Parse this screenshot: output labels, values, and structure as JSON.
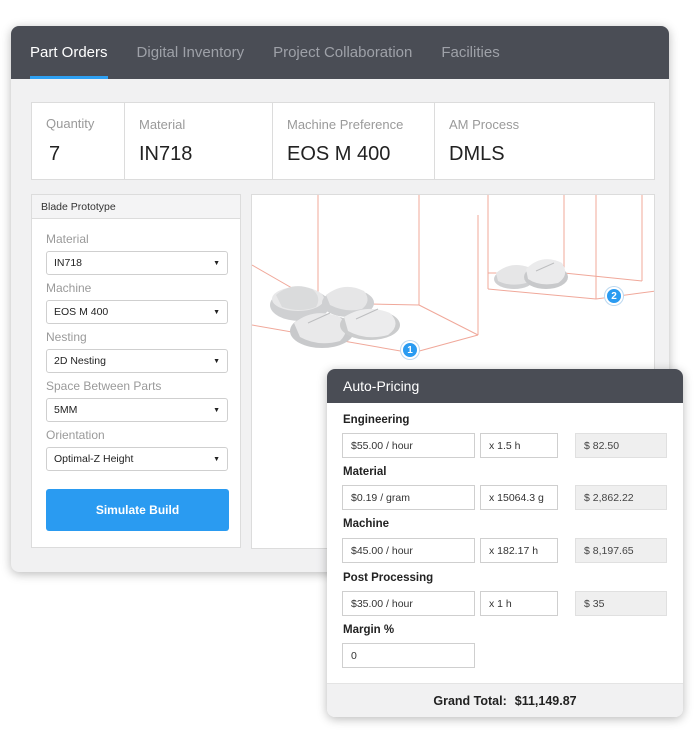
{
  "tabs": [
    {
      "label": "Part Orders",
      "active": true
    },
    {
      "label": "Digital Inventory",
      "active": false
    },
    {
      "label": "Project Collaboration",
      "active": false
    },
    {
      "label": "Facilities",
      "active": false
    }
  ],
  "summary": {
    "quantity": {
      "label": "Quantity",
      "value": "7"
    },
    "material": {
      "label": "Material",
      "value": "IN718"
    },
    "machine": {
      "label": "Machine Preference",
      "value": "EOS M 400"
    },
    "process": {
      "label": "AM  Process",
      "value": "DMLS"
    }
  },
  "panel": {
    "title": "Blade Prototype",
    "fields": {
      "material": {
        "label": "Material",
        "value": "IN718"
      },
      "machine": {
        "label": "Machine",
        "value": "EOS M 400"
      },
      "nesting": {
        "label": "Nesting",
        "value": "2D Nesting"
      },
      "spacing": {
        "label": "Space Between Parts",
        "value": "5MM"
      },
      "orientation": {
        "label": "Orientation",
        "value": "Optimal-Z Height"
      }
    },
    "simulate_label": "Simulate Build"
  },
  "viewport": {
    "badge1": "1",
    "badge2": "2"
  },
  "pricing": {
    "title": "Auto-Pricing",
    "engineering": {
      "label": "Engineering",
      "rate": "$55.00 / hour",
      "qty": "x 1.5 h",
      "total": "$ 82.50"
    },
    "material": {
      "label": "Material",
      "rate": "$0.19 / gram",
      "qty": "x 15064.3 g",
      "total": "$ 2,862.22"
    },
    "machine": {
      "label": "Machine",
      "rate": "$45.00 / hour",
      "qty": "x 182.17 h",
      "total": "$ 8,197.65"
    },
    "post": {
      "label": "Post Processing",
      "rate": "$35.00 / hour",
      "qty": "x 1 h",
      "total": "$ 35"
    },
    "margin": {
      "label": "Margin %",
      "value": "0"
    },
    "grand_total_label": "Grand Total:",
    "grand_total_value": "$11,149.87"
  },
  "colors": {
    "accent": "#2a9bf1",
    "header": "#4a4d55",
    "build_box_lines": "#f0a89a"
  }
}
